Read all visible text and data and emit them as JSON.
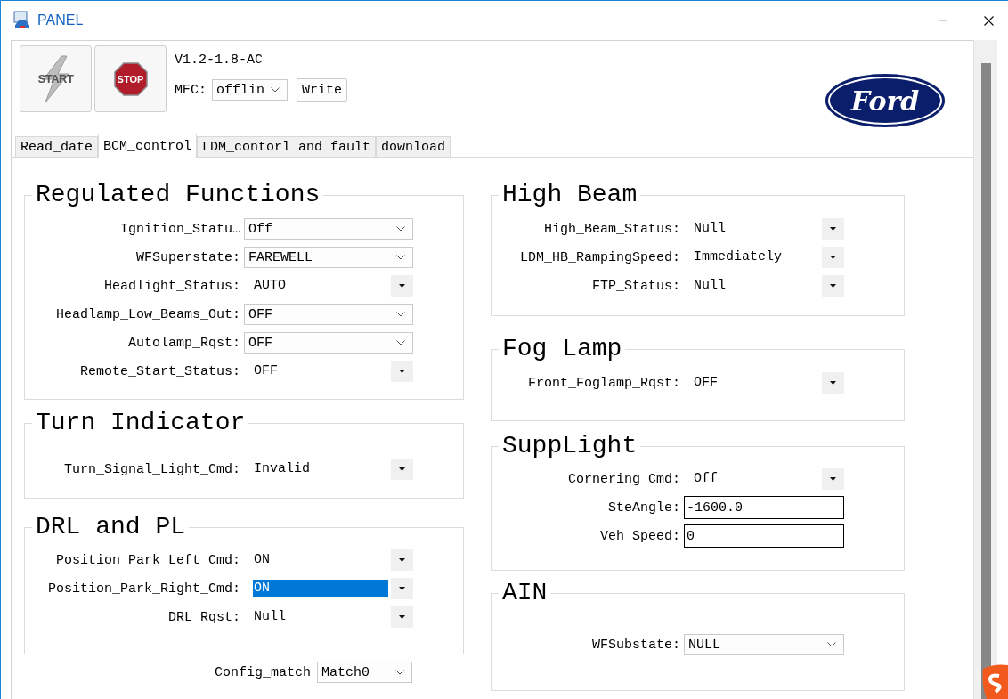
{
  "window": {
    "title": "PANEL"
  },
  "toolbar": {
    "start_button": {
      "label": "START",
      "disabled": true
    },
    "stop_button": {
      "label": "STOP"
    },
    "version": "V1.2-1.8-AC",
    "mec": {
      "label": "MEC:",
      "value": "offlin"
    },
    "write_button": "Write",
    "logo": "Ford"
  },
  "tabs": [
    {
      "label": "Read_date",
      "selected": false
    },
    {
      "label": "BCM_control",
      "selected": true
    },
    {
      "label": "LDM_contorl and fault",
      "selected": false
    },
    {
      "label": "download",
      "selected": false
    }
  ],
  "left_groups": [
    {
      "title": "Regulated Functions",
      "rows": [
        {
          "label": "Ignition_Statu…",
          "kind": "combo",
          "value": "Off",
          "highlighted": false
        },
        {
          "label": "WFSuperstate:",
          "kind": "combo",
          "value": "FAREWELL",
          "highlighted": false
        },
        {
          "label": "Headlight_Status:",
          "kind": "dropdown",
          "value": "AUTO",
          "highlighted": false
        },
        {
          "label": "Headlamp_Low_Beams_Out:",
          "kind": "combo",
          "value": "OFF",
          "highlighted": false
        },
        {
          "label": "Autolamp_Rqst:",
          "kind": "combo",
          "value": "OFF",
          "highlighted": false
        },
        {
          "label": "Remote_Start_Status:",
          "kind": "dropdown",
          "value": "OFF",
          "highlighted": false
        }
      ]
    },
    {
      "title": "Turn Indicator",
      "rows": [
        {
          "label": "Turn_Signal_Light_Cmd:",
          "kind": "dropdown",
          "value": "Invalid",
          "highlighted": false
        }
      ]
    },
    {
      "title": "DRL and PL",
      "rows": [
        {
          "label": "Position_Park_Left_Cmd:",
          "kind": "dropdown",
          "value": "ON",
          "highlighted": false
        },
        {
          "label": "Position_Park_Right_Cmd:",
          "kind": "dropdown",
          "value": "ON",
          "highlighted": true
        },
        {
          "label": "DRL_Rqst:",
          "kind": "dropdown",
          "value": "Null",
          "highlighted": false
        }
      ]
    }
  ],
  "config_match": {
    "label": "Config_match",
    "value": "Match0"
  },
  "right_groups": [
    {
      "title": "High Beam",
      "rows": [
        {
          "label": "High_Beam_Status:",
          "kind": "dropdown",
          "value": "Null",
          "highlighted": false
        },
        {
          "label": "LDM_HB_RampingSpeed:",
          "kind": "dropdown",
          "value": "Immediately",
          "highlighted": false
        },
        {
          "label": "FTP_Status:",
          "kind": "dropdown",
          "value": "Null",
          "highlighted": false
        }
      ]
    },
    {
      "title": "Fog Lamp",
      "rows": [
        {
          "label": "Front_Foglamp_Rqst:",
          "kind": "dropdown",
          "value": "OFF",
          "highlighted": false
        }
      ]
    },
    {
      "title": "SuppLight",
      "rows": [
        {
          "label": "Cornering_Cmd:",
          "kind": "dropdown",
          "value": "Off",
          "highlighted": false
        },
        {
          "label": "SteAngle:",
          "kind": "input",
          "value": "-1600.0",
          "highlighted": false
        },
        {
          "label": "Veh_Speed:",
          "kind": "input",
          "value": "0",
          "highlighted": false
        }
      ]
    },
    {
      "title": "AIN",
      "rows": [
        {
          "label": "WFSubstate:",
          "kind": "combo",
          "value": "NULL",
          "highlighted": false
        }
      ]
    }
  ]
}
